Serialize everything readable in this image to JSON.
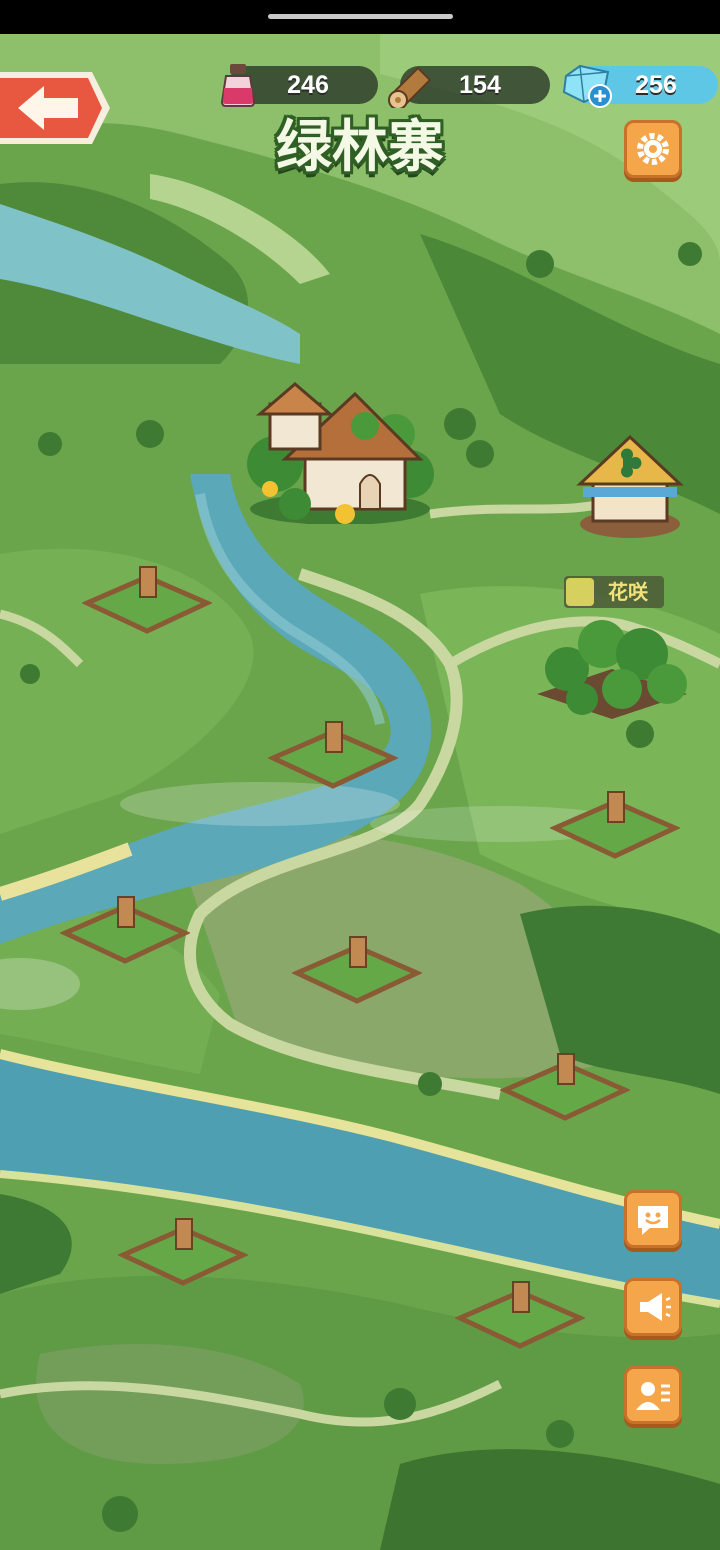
{
  "screen": {
    "title": "绿林寨"
  },
  "resources": {
    "potion": {
      "value": "246",
      "icon": "potion-icon",
      "color": "#d93a6a"
    },
    "wood": {
      "value": "154",
      "icon": "wood-log-icon",
      "color": "#b37a3e"
    },
    "gems": {
      "value": "256",
      "icon": "crystal-icon",
      "color": "#5fc7e6"
    }
  },
  "buttons": {
    "back": {
      "icon": "back-arrow-icon",
      "color": "#e8573f"
    },
    "settings": {
      "icon": "gear-icon"
    },
    "chat": {
      "icon": "chat-smile-icon"
    },
    "announce": {
      "icon": "megaphone-icon"
    },
    "profile": {
      "icon": "profile-card-icon"
    }
  },
  "locations": {
    "flower_shop_label": "花咲"
  },
  "plots": {
    "count": 9,
    "state": "empty"
  },
  "colors": {
    "accent": "#f5a64a",
    "river": "#5aa8b8",
    "grass": "#5f9a45"
  }
}
